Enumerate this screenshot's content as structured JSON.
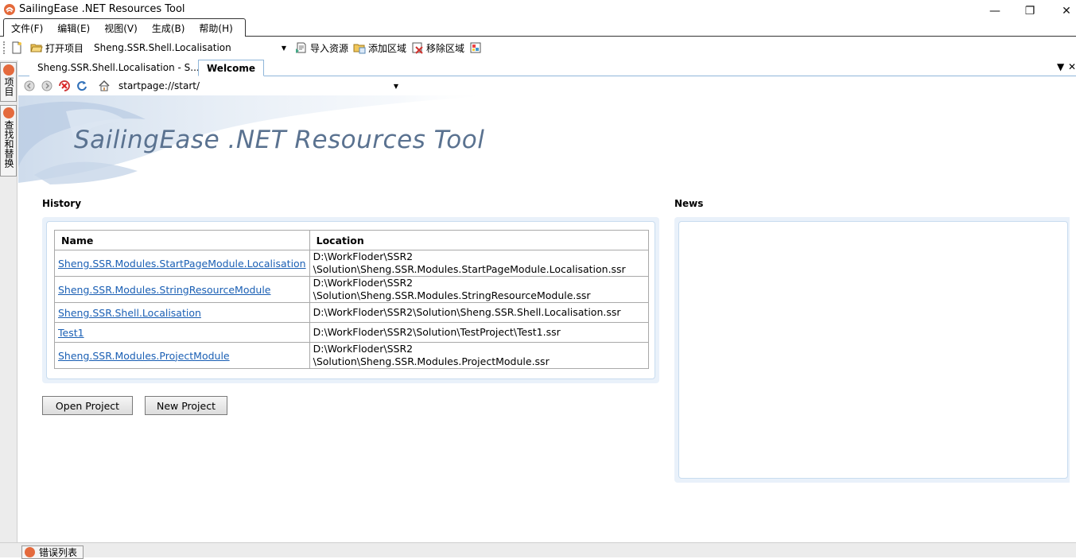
{
  "window": {
    "title": "SailingEase .NET Resources Tool",
    "minimize_glyph": "—",
    "restore_glyph": "❐",
    "close_glyph": "✕"
  },
  "menu": {
    "items": [
      {
        "label": "文件(F)"
      },
      {
        "label": "编辑(E)"
      },
      {
        "label": "视图(V)"
      },
      {
        "label": "生成(B)"
      },
      {
        "label": "帮助(H)"
      }
    ]
  },
  "toolbar": {
    "open_project": "打开项目",
    "project_combo": "Sheng.SSR.Shell.Localisation",
    "import_resource": "导入资源",
    "add_region": "添加区域",
    "remove_region": "移除区域"
  },
  "left_dock": {
    "tab_project": "项目",
    "tab_find": "查找和替换"
  },
  "doc_tabs": [
    {
      "label": "Sheng.SSR.Shell.Localisation - S...",
      "active": false
    },
    {
      "label": "Welcome",
      "active": true
    }
  ],
  "address": {
    "url": "startpage://start/"
  },
  "start_page": {
    "banner_title": "SailingEase .NET Resources Tool",
    "history_label": "History",
    "news_label": "News",
    "history_table": {
      "headers": [
        "Name",
        "Location"
      ],
      "rows": [
        {
          "name": "Sheng.SSR.Modules.StartPageModule.Localisation",
          "loc1": "D:\\WorkFloder\\SSR2",
          "loc2": "\\Solution\\Sheng.SSR.Modules.StartPageModule.Localisation.ssr"
        },
        {
          "name": "Sheng.SSR.Modules.StringResourceModule",
          "loc1": "D:\\WorkFloder\\SSR2",
          "loc2": "\\Solution\\Sheng.SSR.Modules.StringResourceModule.ssr"
        },
        {
          "name": "Sheng.SSR.Shell.Localisation",
          "loc1": "D:\\WorkFloder\\SSR2\\Solution\\Sheng.SSR.Shell.Localisation.ssr",
          "loc2": ""
        },
        {
          "name": "Test1",
          "loc1": "D:\\WorkFloder\\SSR2\\Solution\\TestProject\\Test1.ssr",
          "loc2": ""
        },
        {
          "name": "Sheng.SSR.Modules.ProjectModule",
          "loc1": "D:\\WorkFloder\\SSR2",
          "loc2": "\\Solution\\Sheng.SSR.Modules.ProjectModule.ssr"
        }
      ]
    },
    "open_project_button": "Open Project",
    "new_project_button": "New Project"
  },
  "bottom_dock": {
    "error_list": "错误列表"
  },
  "colors": {
    "accent_blue": "#8fb6d9",
    "link": "#1a5fb4",
    "banner_text": "#5a7290",
    "panel_bg": "#e9f1fa"
  }
}
